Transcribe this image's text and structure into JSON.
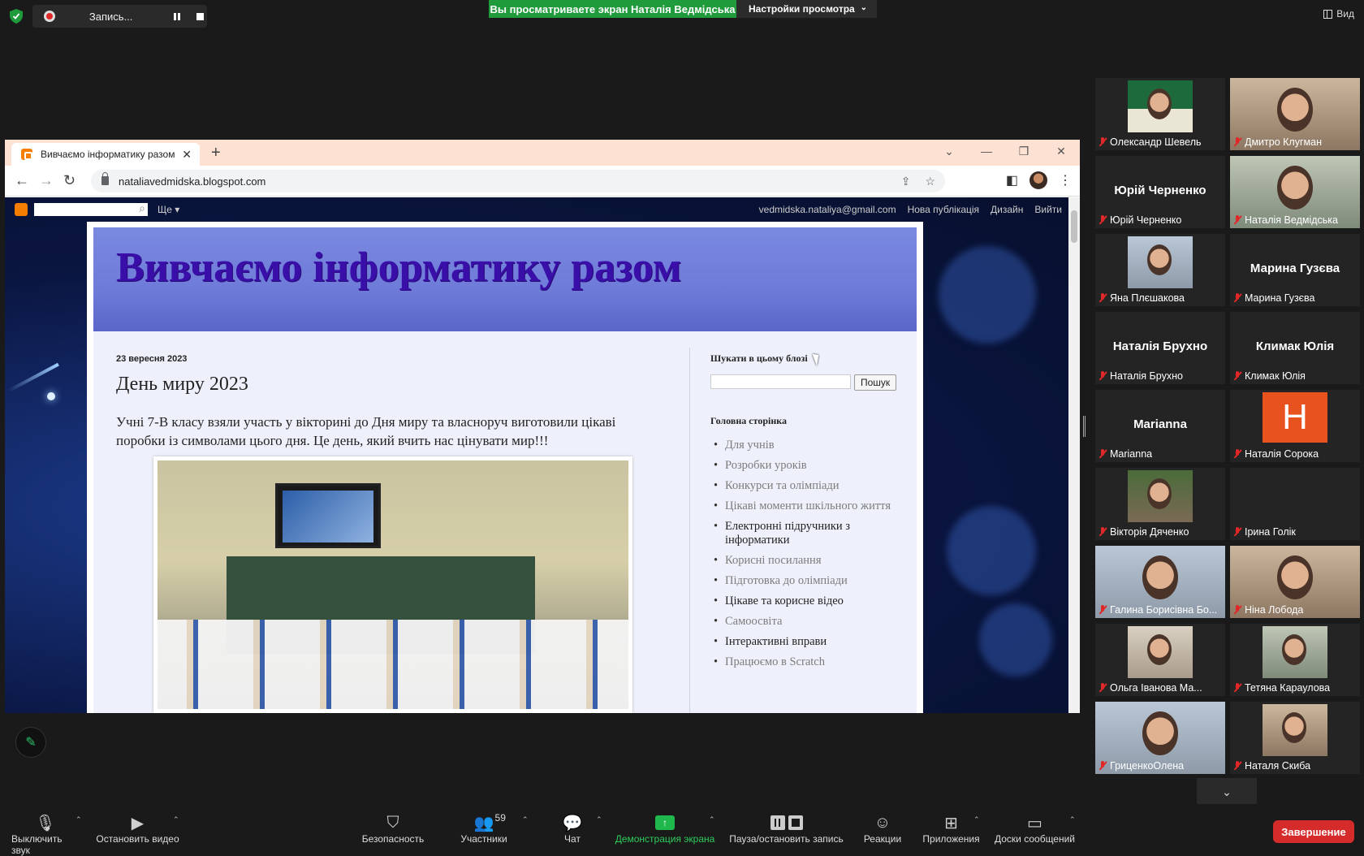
{
  "topbar": {
    "recording_label": "Запись...",
    "viewing_banner": "Вы просматриваете экран Наталія Ведмідська",
    "view_settings": "Настройки просмотра",
    "view_button": "Вид"
  },
  "browser": {
    "tab_title": "Вивчаємо інформатику разом",
    "url": "nataliavedmidska.blogspot.com"
  },
  "blogger_nav": {
    "more": "Ще",
    "email": "vedmidska.nataliya@gmail.com",
    "new_post": "Нова публікація",
    "design": "Дизайн",
    "sign_out": "Вийти"
  },
  "blog": {
    "title": "Вивчаємо інформатику разом",
    "post": {
      "date": "23 вересня 2023",
      "title": "День миру 2023",
      "body": "Учні 7-В класу взяли участь у вікторині до Дня миру та власноруч виготовили цікаві поробки із символами цього дня. Це день, який вчить нас цінувати мир!!!"
    },
    "sidebar": {
      "search_heading": "Шукати в цьому блозі",
      "search_button": "Пошук",
      "pages_heading": "Головна сторінка",
      "pages": [
        {
          "label": "Для учнів",
          "visited": true
        },
        {
          "label": "Розробки уроків",
          "visited": true
        },
        {
          "label": "Конкурси та олімпіади",
          "visited": true
        },
        {
          "label": "Цікаві моменти шкільного життя",
          "visited": true
        },
        {
          "label": "Електронні підручники з інформатики",
          "visited": false
        },
        {
          "label": "Корисні посилання",
          "visited": true
        },
        {
          "label": "Підготовка до олімпіади",
          "visited": true
        },
        {
          "label": "Цікаве та корисне відео",
          "visited": false
        },
        {
          "label": "Самоосвіта",
          "visited": true
        },
        {
          "label": "Інтерактивні вправи",
          "visited": false
        },
        {
          "label": "Працюємо в Scratch",
          "visited": true
        }
      ]
    }
  },
  "participants": [
    {
      "name": "Олександр Шевель",
      "type": "image"
    },
    {
      "name": "Дмитро Клугман",
      "type": "video"
    },
    {
      "name": "Юрій Черненко",
      "type": "name"
    },
    {
      "name": "Наталія Ведмідська",
      "type": "video",
      "active": true
    },
    {
      "name": "Яна Плєшакова",
      "type": "video"
    },
    {
      "name": "Марина Гузєва",
      "type": "name"
    },
    {
      "name": "Наталія Брухно",
      "type": "name"
    },
    {
      "name": "Климак Юлія",
      "type": "name"
    },
    {
      "name": "Marianna",
      "type": "name"
    },
    {
      "name": "Наталія Сорока",
      "type": "avatar",
      "initial": "Н"
    },
    {
      "name": "Вікторія Дяченко",
      "type": "image"
    },
    {
      "name": "Ірина Голік",
      "type": "blank"
    },
    {
      "name": "Галина Борисівна Бо...",
      "type": "video"
    },
    {
      "name": "Ніна Лобода",
      "type": "video"
    },
    {
      "name": "Ольга Іванова Ма...",
      "type": "video"
    },
    {
      "name": "Тетяна Караулова",
      "type": "video"
    },
    {
      "name": "ГриценкоОлена",
      "type": "video"
    },
    {
      "name": "Наталя Скиба",
      "type": "video"
    }
  ],
  "bottombar": {
    "mute": "Выключить звук",
    "video": "Остановить видео",
    "security": "Безопасность",
    "participants": "Участники",
    "participants_count": "59",
    "chat": "Чат",
    "share": "Демонстрация экрана",
    "pause_record": "Пауза/остановить запись",
    "reactions": "Реакции",
    "apps": "Приложения",
    "whiteboards": "Доски сообщений",
    "end": "Завершение"
  }
}
